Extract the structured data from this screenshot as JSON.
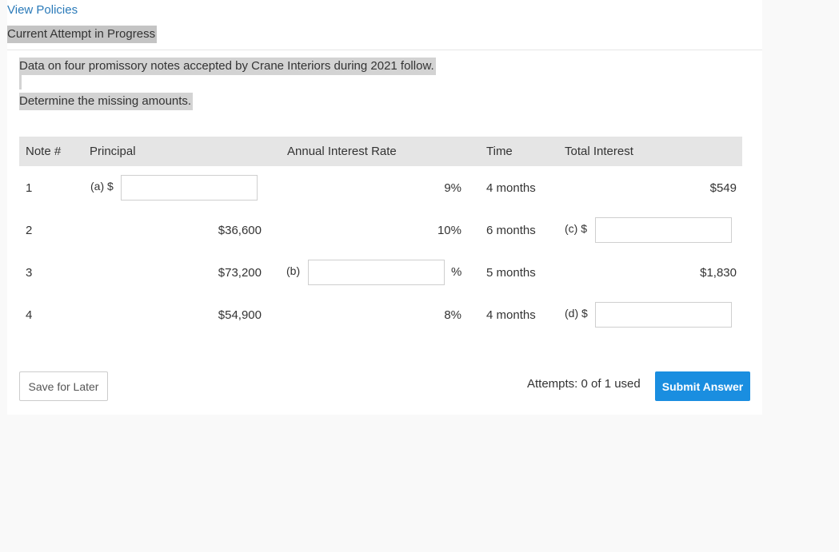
{
  "header": {
    "view_policies": "View Policies",
    "attempt_status": "Current Attempt in Progress"
  },
  "question": {
    "line1": "Data on four promissory notes accepted by Crane Interiors during 2021 follow.",
    "line2": "Determine the missing amounts."
  },
  "table": {
    "headers": {
      "note": "Note #",
      "principal": "Principal",
      "rate": "Annual Interest Rate",
      "time": "Time",
      "interest": "Total Interest"
    },
    "rows": [
      {
        "note": "1",
        "principal_prefix": "(a) $",
        "principal": "",
        "rate": "9%",
        "time": "4 months",
        "interest": "$549"
      },
      {
        "note": "2",
        "principal": "$36,600",
        "rate": "10%",
        "time": "6 months",
        "interest_prefix": "(c) $",
        "interest": ""
      },
      {
        "note": "3",
        "principal": "$73,200",
        "rate_prefix": "(b)",
        "rate": "",
        "rate_suffix": "%",
        "time": "5 months",
        "interest": "$1,830"
      },
      {
        "note": "4",
        "principal": "$54,900",
        "rate": "8%",
        "time": "4 months",
        "interest_prefix": "(d) $",
        "interest": ""
      }
    ]
  },
  "footer": {
    "save_label": "Save for Later",
    "attempts_text": "Attempts: 0 of 1 used",
    "submit_label": "Submit Answer"
  }
}
